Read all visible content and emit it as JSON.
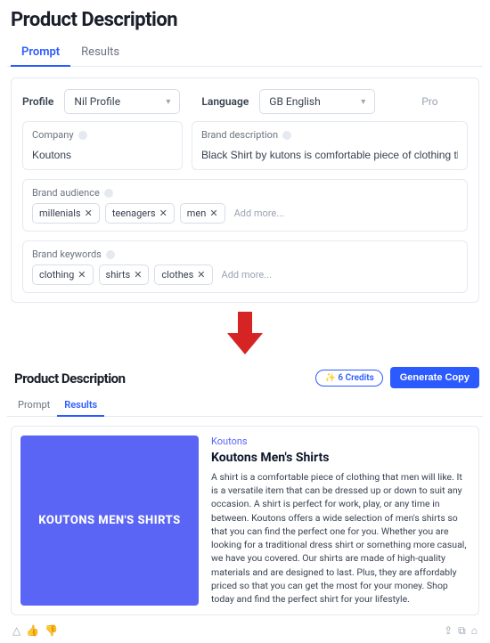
{
  "page1": {
    "title": "Product Description",
    "tabs": {
      "prompt": "Prompt",
      "results": "Results"
    },
    "profile": {
      "label": "Profile",
      "value": "Nil Profile"
    },
    "language": {
      "label": "Language",
      "value": "GB English"
    },
    "truncated_label": "Pro",
    "company": {
      "label": "Company",
      "value": "Koutons"
    },
    "brand_desc": {
      "label": "Brand description",
      "value": "Black Shirt by kutons is comfortable piece of clothing that men will like"
    },
    "audience": {
      "label": "Brand audience",
      "tags": [
        "millenials",
        "teenagers",
        "men"
      ],
      "add_more": "Add more..."
    },
    "keywords": {
      "label": "Brand keywords",
      "tags": [
        "clothing",
        "shirts",
        "clothes"
      ],
      "add_more": "Add more..."
    }
  },
  "page2": {
    "title": "Product Description",
    "tabs": {
      "prompt": "Prompt",
      "results": "Results"
    },
    "credits": "✨ 6 Credits",
    "generate": "Generate Copy",
    "result": {
      "brand": "Koutons",
      "banner": "KOUTONS MEN'S SHIRTS",
      "title": "Koutons Men's Shirts",
      "body": "A shirt is a comfortable piece of clothing that men will like. It is a versatile item that can be dressed up or down to suit any occasion. A shirt is perfect for work, play, or any time in between. Koutons offers a wide selection of men's shirts so that you can find the perfect one for you. Whether you are looking for a traditional dress shirt or something more casual, we have you covered. Our shirts are made of high-quality materials and are designed to last. Plus, they are affordably priced so that you can get the most for your money. Shop today and find the perfect shirt for your lifestyle."
    }
  }
}
